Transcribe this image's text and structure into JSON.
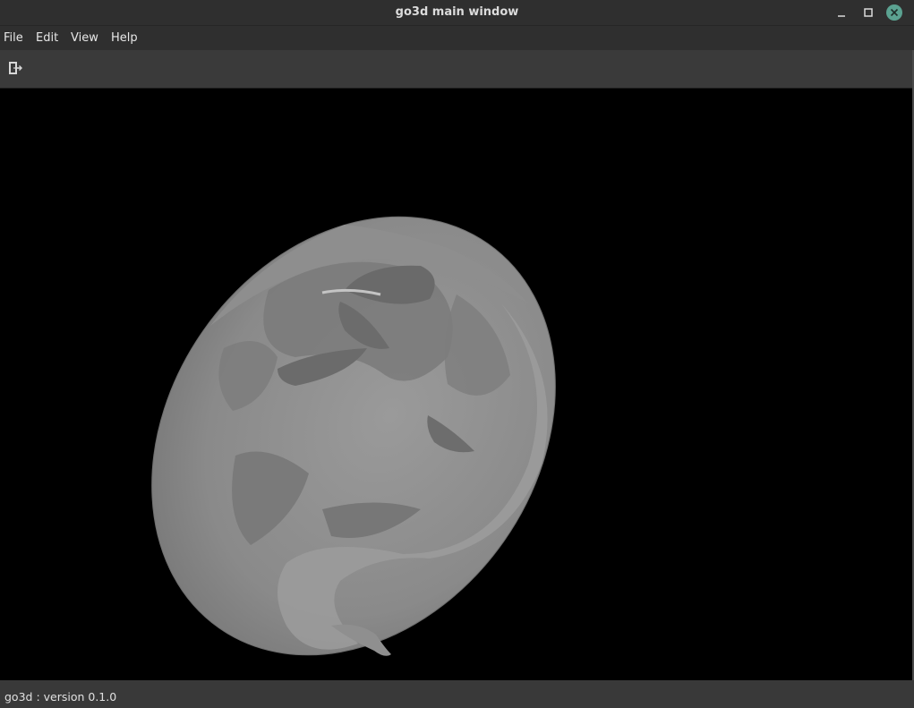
{
  "window": {
    "title": "go3d main window",
    "close_color": "#5ba291"
  },
  "menu": {
    "items": [
      "File",
      "Edit",
      "View",
      "Help"
    ]
  },
  "toolbar": {
    "exit_icon": "exit-door-icon"
  },
  "viewport": {
    "background": "#000000",
    "model_color": "#8a8a8a"
  },
  "status": {
    "text": "go3d : version 0.1.0"
  }
}
